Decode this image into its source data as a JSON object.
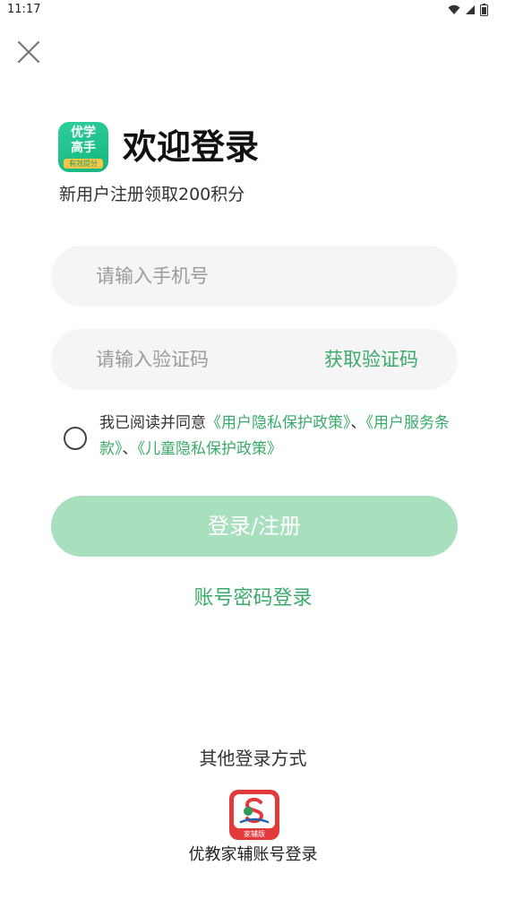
{
  "status_bar": {
    "time": "11:17",
    "icons": [
      "wifi-icon",
      "signal-icon",
      "battery-icon"
    ]
  },
  "header": {
    "close_icon": "close-icon"
  },
  "brand": {
    "logo_line1": "优学",
    "logo_line2": "高手",
    "logo_strip": "有效提分",
    "title": "欢迎登录",
    "subtitle": "新用户注册领取200积分"
  },
  "form": {
    "phone_placeholder": "请输入手机号",
    "code_placeholder": "请输入验证码",
    "get_code_label": "获取验证码"
  },
  "agreement": {
    "prefix": "我已阅读并同意",
    "link_privacy": "《用户隐私保护政策》",
    "sep1": "、",
    "link_terms": "《用户服务条款》",
    "sep2": "、",
    "link_child": "《儿童隐私保护政策》"
  },
  "actions": {
    "login_label": "登录/注册",
    "password_login_label": "账号密码登录"
  },
  "other_login": {
    "title": "其他登录方式",
    "provider_icon_strip": "家辅版",
    "provider_label": "优教家辅账号登录"
  },
  "colors": {
    "accent_green": "#3aaa6a",
    "login_button": "#a8e0bf",
    "field_bg": "#f5f5f5",
    "provider_red": "#e23a3a"
  }
}
